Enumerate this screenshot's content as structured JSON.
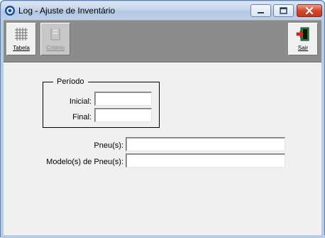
{
  "window": {
    "title": "Log - Ajuste de Inventário",
    "controls": {
      "minimize_icon": "minimize-icon",
      "maximize_icon": "maximize-icon",
      "close_icon": "close-icon"
    }
  },
  "toolbar": {
    "buttons": [
      {
        "label": "Tabela",
        "icon": "grid-table-icon",
        "enabled": true
      },
      {
        "label": "Critério",
        "icon": "criteria-icon",
        "enabled": false
      },
      {
        "label": "Sair",
        "icon": "exit-door-icon",
        "enabled": true
      }
    ]
  },
  "form": {
    "period_group": {
      "title": "Período",
      "initial_label": "Inicial:",
      "initial_value": "",
      "final_label": "Final:",
      "final_value": ""
    },
    "tires_label": "Pneu(s):",
    "tires_value": "",
    "tire_models_label": "Modelo(s) de Pneu(s):",
    "tire_models_value": ""
  },
  "colors": {
    "title_gradient_top": "#dbe6f3",
    "toolbar_bg": "#8c8c8c",
    "content_bg": "#f0f0f0",
    "close_button": "#c23a22"
  }
}
